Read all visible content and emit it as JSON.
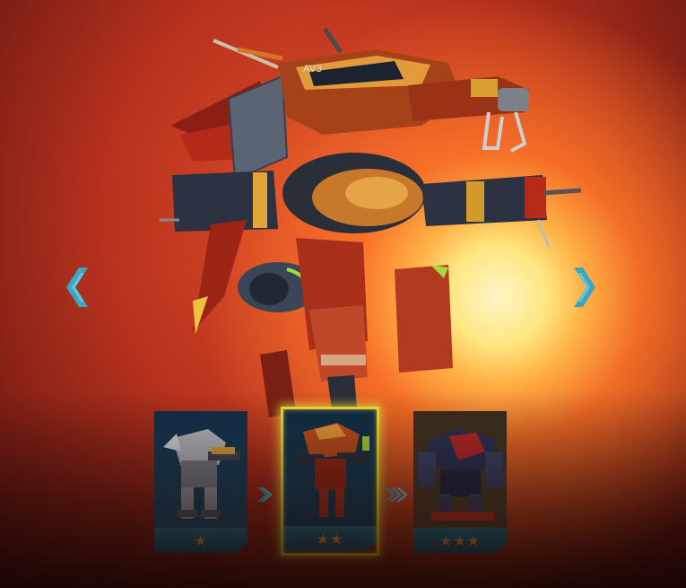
{
  "hero_mech": {
    "hull_marking": "AV3"
  },
  "navigation": {
    "prev_icon": "chevron-left-icon",
    "next_icon": "chevron-right-icon"
  },
  "upgrade_tiers": [
    {
      "stars_text": "★",
      "star_count": 1,
      "selected": false
    },
    {
      "stars_text": "★★",
      "star_count": 2,
      "selected": true
    },
    {
      "stars_text": "★★★",
      "star_count": 3,
      "selected": false
    }
  ],
  "tier_separators": [
    {
      "icon": "single-chevron-right-icon"
    },
    {
      "icon": "double-chevron-right-icon"
    }
  ],
  "colors": {
    "accent_teal": "#3aa6c2",
    "selected_frame": "#f4e23a",
    "star": "#f2a645",
    "card_footer": "#2f7f9a",
    "background_red": "#b8321e",
    "sun": "#ffe680"
  }
}
